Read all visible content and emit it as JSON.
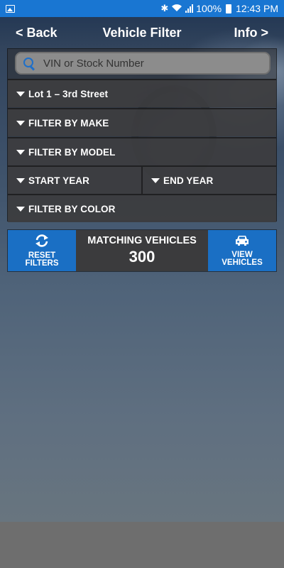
{
  "status_bar": {
    "battery": "100%",
    "time": "12:43 PM"
  },
  "nav": {
    "back_label": "< Back",
    "title": "Vehicle Filter",
    "info_label": "Info >"
  },
  "search": {
    "placeholder": "VIN or Stock Number",
    "value": ""
  },
  "filters": {
    "location": "Lot 1 – 3rd Street",
    "make": "FILTER BY MAKE",
    "model": "FILTER BY MODEL",
    "start_year": "START YEAR",
    "end_year": "END YEAR",
    "color": "FILTER BY COLOR"
  },
  "actions": {
    "reset_label_line1": "RESET",
    "reset_label_line2": "FILTERS",
    "matching_label": "MATCHING VEHICLES",
    "matching_count": "300",
    "view_label_line1": "VIEW",
    "view_label_line2": "VEHICLES"
  },
  "colors": {
    "status_bar": "#1976d2",
    "accent_button": "#1a6fc4",
    "search_icon": "#1e6fc9"
  },
  "icons": {
    "status_left": "image-icon",
    "status_right": [
      "bluetooth-icon",
      "wifi-icon",
      "signal-icon",
      "battery-icon"
    ],
    "search": "search-icon",
    "dropdown": "triangle-down-icon",
    "reset": "refresh-icon",
    "view": "car-icon"
  }
}
